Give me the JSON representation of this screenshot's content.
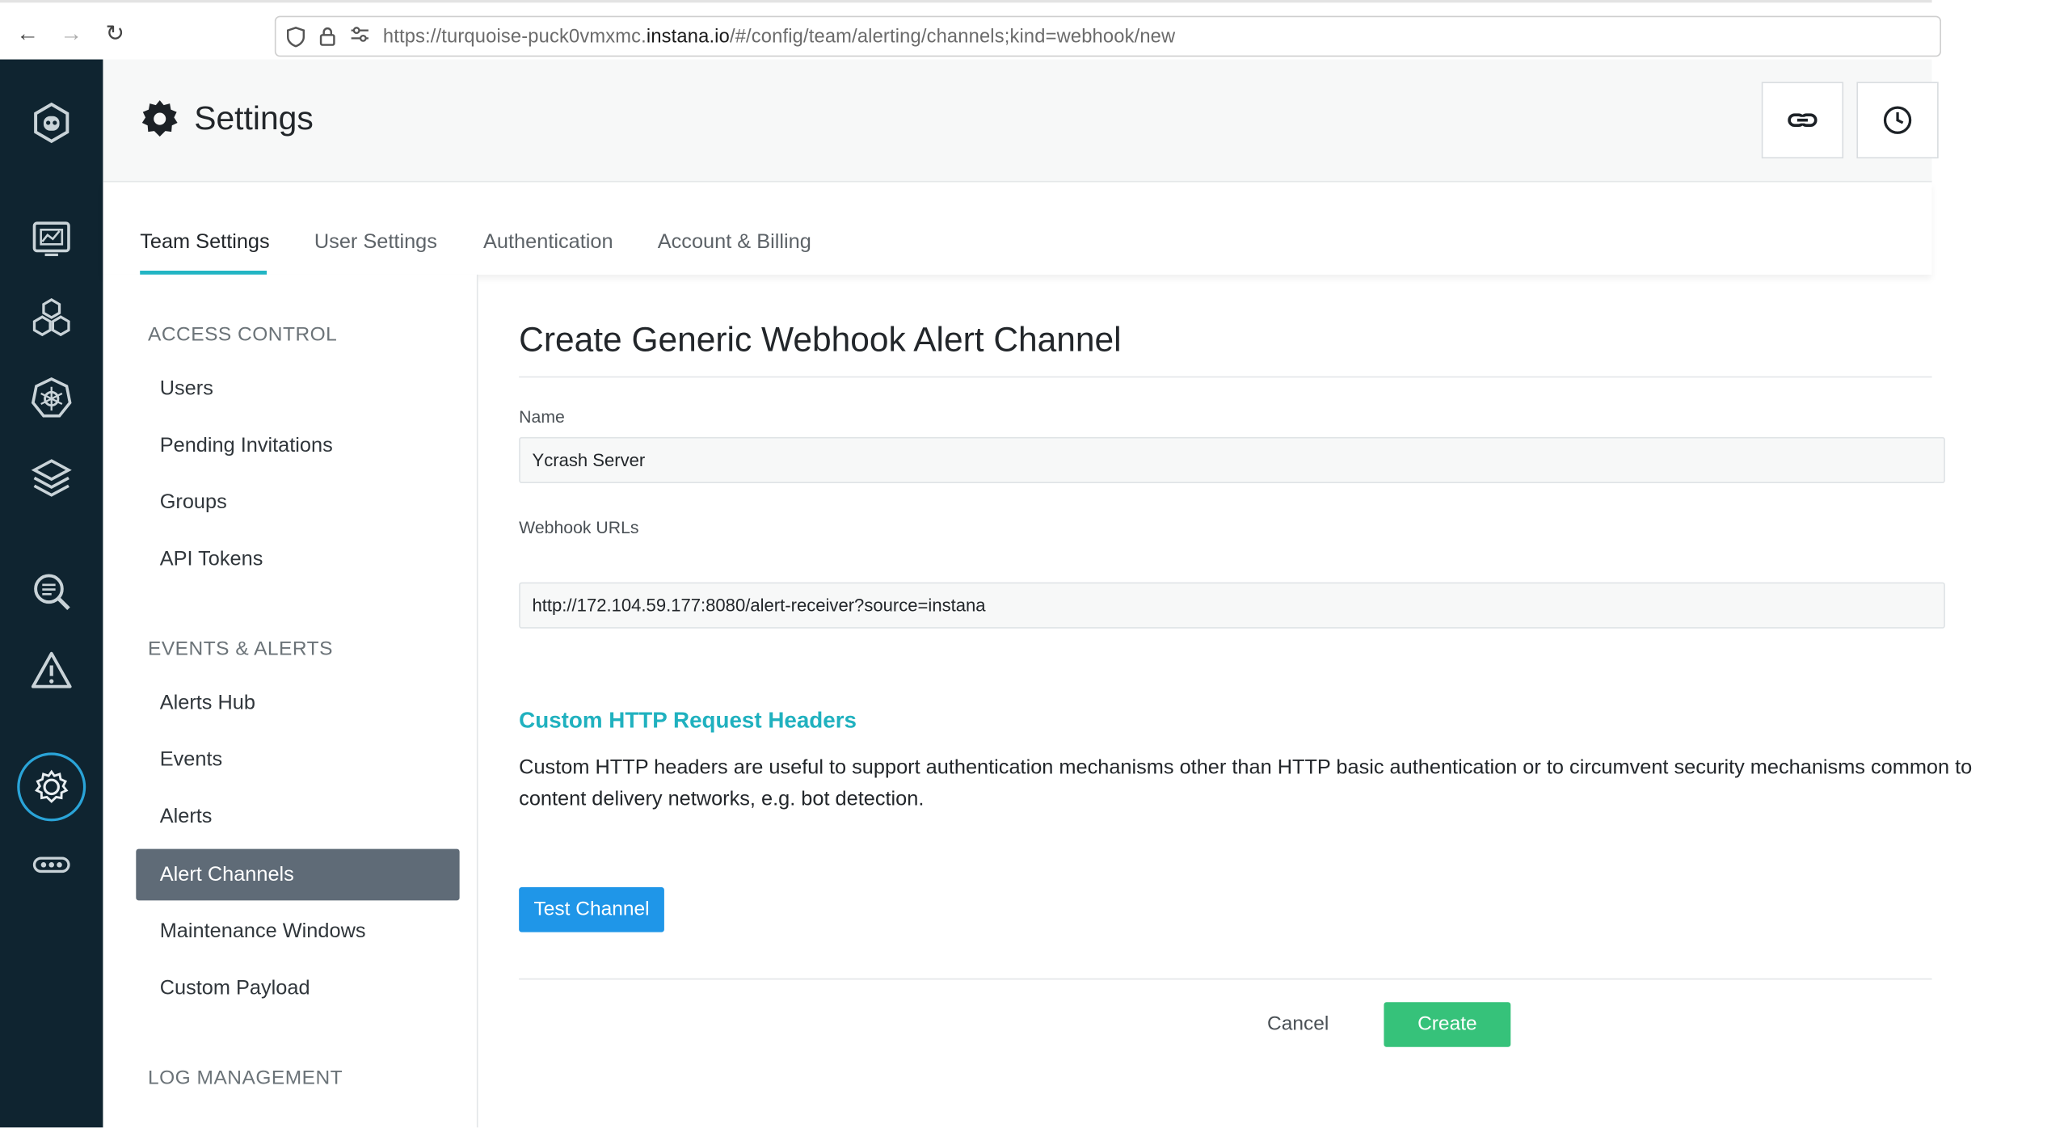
{
  "browser": {
    "url_prefix": "https://turquoise-puck0vmxmc.",
    "url_domain": "instana.io",
    "url_path": "/#/config/team/alerting/channels;kind=webhook/new"
  },
  "header": {
    "title": "Settings"
  },
  "tabs": [
    {
      "label": "Team Settings"
    },
    {
      "label": "User Settings"
    },
    {
      "label": "Authentication"
    },
    {
      "label": "Account & Billing"
    }
  ],
  "sidebar": {
    "sections": [
      {
        "title": "ACCESS CONTROL",
        "items": [
          {
            "label": "Users"
          },
          {
            "label": "Pending Invitations"
          },
          {
            "label": "Groups"
          },
          {
            "label": "API Tokens"
          }
        ]
      },
      {
        "title": "EVENTS & ALERTS",
        "items": [
          {
            "label": "Alerts Hub"
          },
          {
            "label": "Events"
          },
          {
            "label": "Alerts"
          },
          {
            "label": "Alert Channels"
          },
          {
            "label": "Maintenance Windows"
          },
          {
            "label": "Custom Payload"
          }
        ]
      },
      {
        "title": "LOG MANAGEMENT",
        "items": []
      }
    ]
  },
  "form": {
    "title": "Create Generic Webhook Alert Channel",
    "name_label": "Name",
    "name_value": "Ycrash Server",
    "urls_label": "Webhook URLs",
    "url_value": "http://172.104.59.177:8080/alert-receiver?source=instana",
    "headers_title": "Custom HTTP Request Headers",
    "headers_desc": "Custom HTTP headers are useful to support authentication mechanisms other than HTTP basic authentication or to circumvent security mechanisms common to content delivery networks, e.g. bot detection.",
    "test_button": "Test Channel",
    "cancel_button": "Cancel",
    "create_button": "Create"
  },
  "colors": {
    "rail": "#0f2430",
    "accent": "#22b5c4",
    "test_button": "#1f96e8",
    "create_button": "#36c27a",
    "active_menu": "#5f6b77"
  }
}
